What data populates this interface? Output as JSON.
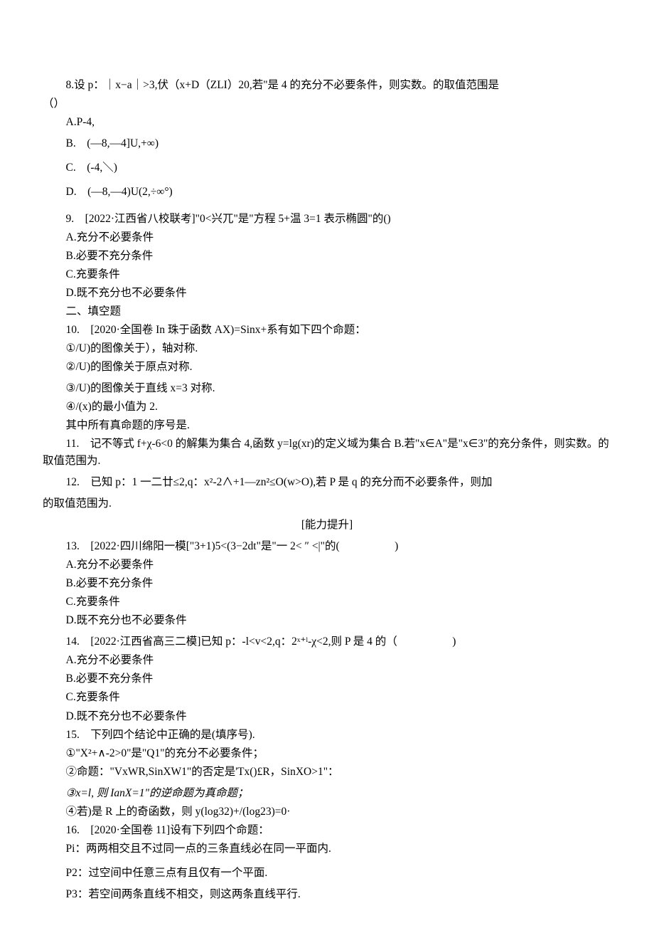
{
  "q8": {
    "stem_l1": "8.设 p：｜x−a｜>3,伏（x+D（ZLI）20,若\"是 4 的充分不必要条件，则实数。的取值范围是",
    "stem_l2": "（）",
    "a": "A.P-4,",
    "b": "B.　(—8,—4]U,+∞)",
    "c": "C.　(-4,＼)",
    "d": "D.　(—8,—4)U(2,÷∞°)"
  },
  "q9": {
    "stem": "9.　[2022·江西省八校联考]\"0<兴兀\"是\"方程 5+温 3=1 表示椭圆\"的()",
    "a": "A.充分不必要条件",
    "b": "B.必要不充分条件",
    "c": "C.充要条件",
    "d": "D.既不充分也不必要条件"
  },
  "sec2": "二、填空题",
  "q10": {
    "stem": "10.　[2020·全国卷 In 珠于函数 AX)=Sinx+系有如下四个命题：",
    "l1": "①/U)的图像关于），轴对称.",
    "l2": "②/U)的图像关于原点对称.",
    "l3": "③/U)的图像关于直线 x=3 对称.",
    "l4": "④/(x)的最小值为 2.",
    "l5": "其中所有真命题的序号是."
  },
  "q11": "11.　记不等式 f+χ-6<0 的解集为集合 4,函数 y=lg(xr)的定义域为集合 B.若\"x∈A\"是\"x∈3\"的充分条件，则实数。的取值范围为.",
  "q12": {
    "stem": "12.　已知 p：1 一二廿≤2,q：x²-2∧+1—zn²≤O(w>O),若 P 是 q 的充分而不必要条件，则加",
    "cont": "的取值范围为."
  },
  "sec3": "[能力提升]",
  "q13": {
    "stem": "13.　[2022·四川绵阳一模[\"3+1)5<(3−2dt\"是\"一 2< ″ <|\"的(　　　　　)",
    "a": "A.充分不必要条件",
    "b": "B.必要不充分条件",
    "c": "C.充要条件",
    "d": "D.既不充分也不必要条件"
  },
  "q14": {
    "stem": "14.　[2022·江西省高三二模]已知 p：-l<v<2,q：2ˣ⁺ˡ-χ<2,则 P 是 4 的（　　　　　)",
    "a": "A.充分不必要条件",
    "b": "B.必要不充分条件",
    "c": "C.充要条件",
    "d": "D.既不充分也不必要条件"
  },
  "q15": {
    "stem": "15.　下列四个结论中正确的是(填序号).",
    "l1": "①\"X²+∧-2>0\"是\"Q1\"的充分不必要条件；",
    "l2": "②命题：\"VxWR,SinXW1\"的否定是'Tx()£R，SinXO>1\"：",
    "l3": "③x=l, 则 IanX=1\"的逆命题为真命题；",
    "l4": "④若)是 R 上的奇函数，则 y(log32)+/(log23)=0·"
  },
  "q16": {
    "stem": "16.　[2020·全国卷 11]设有下列四个命题：",
    "l1": "Pi：两两相交且不过同一点的三条直线必在同一平面内.",
    "l2": "P2：过空间中任意三点有且仅有一个平面.",
    "l3": "P3：若空间两条直线不相交，则这两条直线平行."
  }
}
